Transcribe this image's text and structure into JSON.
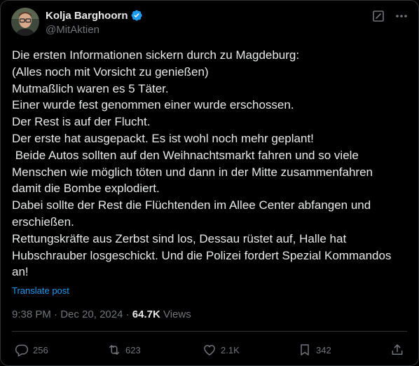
{
  "author": {
    "name": "Kolja Barghoorn",
    "handle": "@MitAktien",
    "avatar_icon": "avatar-photo",
    "verified_color": "#1d9bf0"
  },
  "header_actions": {
    "grok_icon": "grok-icon",
    "more_icon": "more-icon"
  },
  "post": {
    "lines": [
      "Die ersten Informationen sickern durch zu Magdeburg:",
      "(Alles noch mit Vorsicht zu genießen)",
      "Mutmaßlich waren es 5 Täter.",
      "Einer wurde fest genommen einer wurde erschossen.",
      "Der Rest is auf der Flucht.",
      "Der erste hat ausgepackt. Es ist wohl noch mehr geplant!",
      " Beide Autos sollten auf den Weihnachtsmarkt fahren und so viele",
      "Menschen wie möglich töten und dann in der Mitte zusammenfahren",
      "damit die Bombe explodiert.",
      "Dabei sollte der Rest die Flüchtenden im Allee Center abfangen und",
      "erschießen.",
      "Rettungskräfte aus Zerbst sind los, Dessau rüstet auf, Halle hat",
      "Hubschrauber losgeschickt. Und die Polizei fordert Spezial Kommandos",
      "an!"
    ],
    "translate_label": "Translate post"
  },
  "meta": {
    "time": "9:38 PM",
    "separator": " · ",
    "date": "Dec 20, 2024",
    "views_count": "64.7K",
    "views_label": " Views"
  },
  "actions": {
    "replies": "256",
    "reposts": "623",
    "likes": "2.1K",
    "bookmarks": "342"
  },
  "colors": {
    "background": "#000000",
    "text": "#e7e9ea",
    "muted": "#71767b",
    "accent": "#1d9bf0"
  }
}
